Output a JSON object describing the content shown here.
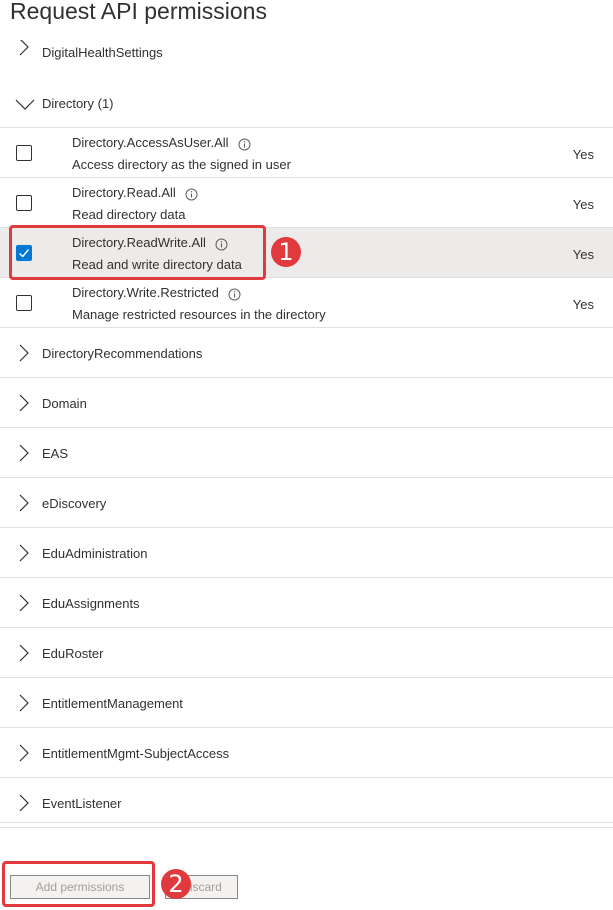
{
  "title": "Request API permissions",
  "cut_group": "DigitalHealthSettings",
  "directory_group": {
    "label": "Directory (1)"
  },
  "permissions": [
    {
      "name": "Directory.AccessAsUser.All",
      "description": "Access directory as the signed in user",
      "admin": "Yes",
      "checked": false
    },
    {
      "name": "Directory.Read.All",
      "description": "Read directory data",
      "admin": "Yes",
      "checked": false
    },
    {
      "name": "Directory.ReadWrite.All",
      "description": "Read and write directory data",
      "admin": "Yes",
      "checked": true
    },
    {
      "name": "Directory.Write.Restricted",
      "description": "Manage restricted resources in the directory",
      "admin": "Yes",
      "checked": false
    }
  ],
  "groups": [
    "DirectoryRecommendations",
    "Domain",
    "EAS",
    "eDiscovery",
    "EduAdministration",
    "EduAssignments",
    "EduRoster",
    "EntitlementManagement",
    "EntitlementMgmt-SubjectAccess",
    "EventListener"
  ],
  "footer": {
    "add_permissions": "Add permissions",
    "discard": "Discard"
  },
  "callouts": [
    "1",
    "2"
  ],
  "colors": {
    "accent": "#0078d4",
    "callout": "#e0393e",
    "selected_row": "#edebe9"
  }
}
